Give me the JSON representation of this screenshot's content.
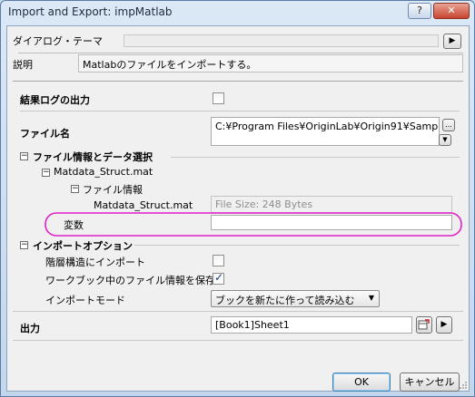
{
  "window": {
    "title": "Import and Export: impMatlab",
    "help_label": "?",
    "close_label": "✕"
  },
  "theme": {
    "label": "ダイアログ・テーマ",
    "value": "",
    "arrow": "▶"
  },
  "description": {
    "label": "説明",
    "text": "Matlabのファイルをインポートする。"
  },
  "log_output": {
    "label": "結果ログの出力",
    "checked": false
  },
  "filename": {
    "label": "ファイル名",
    "value": "C:¥Program Files¥OriginLab¥Origin91¥Samp",
    "browse_label": "...",
    "dropdown_arrow": "▼"
  },
  "file_info_section": {
    "label": "ファイル情報とデータ選択",
    "tree_root": "Matdata_Struct.mat",
    "tree_child": "ファイル情報",
    "info_key": "Matdata_Struct.mat",
    "info_value": "File Size: 248 Bytes",
    "variable_label": "変数",
    "variable_value": ""
  },
  "import_options": {
    "label": "インポートオプション",
    "hierarchical_label": "階層構造にインポート",
    "hierarchical_checked": false,
    "save_info_label": "ワークブック中のファイル情報を保存",
    "save_info_checked": true,
    "mode_label": "インポートモード",
    "mode_value": "ブックを新たに作って読み込む"
  },
  "output": {
    "label": "出力",
    "value": "[Book1]Sheet1"
  },
  "footer": {
    "ok_label": "OK",
    "cancel_label": "キャンセル"
  },
  "colors": {
    "highlight_ellipse": "#e020c8",
    "check_mark": "#1e3a6e"
  }
}
